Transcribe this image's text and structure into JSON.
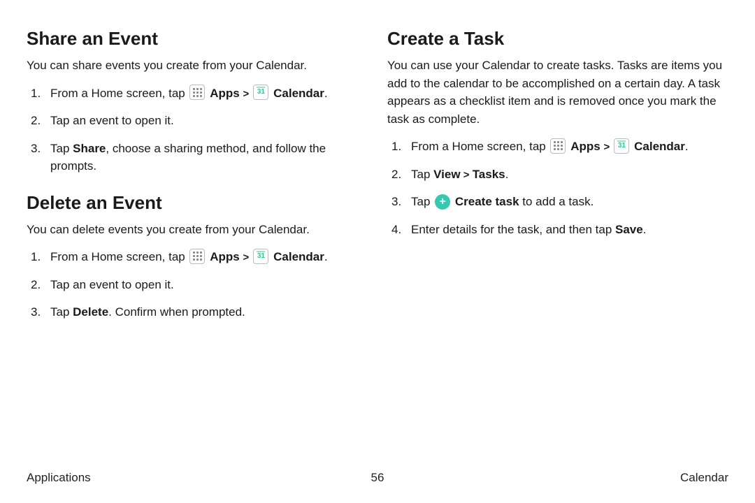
{
  "left": {
    "sectionA": {
      "heading": "Share an Event",
      "intro": "You can share events you create from your Calendar.",
      "steps": {
        "s1_pre": "From a Home screen, tap",
        "s1_apps": "Apps",
        "s1_cal": "Calendar",
        "s2": "Tap an event to open it.",
        "s3_pre": "Tap ",
        "s3_bold": "Share",
        "s3_post": ", choose a sharing method, and follow the prompts."
      }
    },
    "sectionB": {
      "heading": "Delete an Event",
      "intro": "You can delete events you create from your Calendar.",
      "steps": {
        "s1_pre": "From a Home screen, tap",
        "s1_apps": "Apps",
        "s1_cal": "Calendar",
        "s2": "Tap an event to open it.",
        "s3_pre": "Tap ",
        "s3_bold": "Delete",
        "s3_post": ". Confirm when prompted."
      }
    }
  },
  "right": {
    "sectionA": {
      "heading": "Create a Task",
      "intro": "You can use your Calendar to create tasks. Tasks are items you add to the calendar to be accomplished on a certain day. A task appears as a checklist item and is removed once you mark the task as complete.",
      "steps": {
        "s1_pre": "From a Home screen, tap",
        "s1_apps": "Apps",
        "s1_cal": "Calendar",
        "s2_pre": "Tap ",
        "s2_bold1": "View",
        "s2_chev": " > ",
        "s2_bold2": "Tasks",
        "s2_post": ".",
        "s3_pre": "Tap ",
        "s3_bold": "Create task",
        "s3_post": " to add a task.",
        "s4_pre": "Enter details for the task, and then tap ",
        "s4_bold": "Save",
        "s4_post": "."
      }
    }
  },
  "icons": {
    "cal_day": "31"
  },
  "footer": {
    "left": "Applications",
    "center": "56",
    "right": "Calendar"
  }
}
